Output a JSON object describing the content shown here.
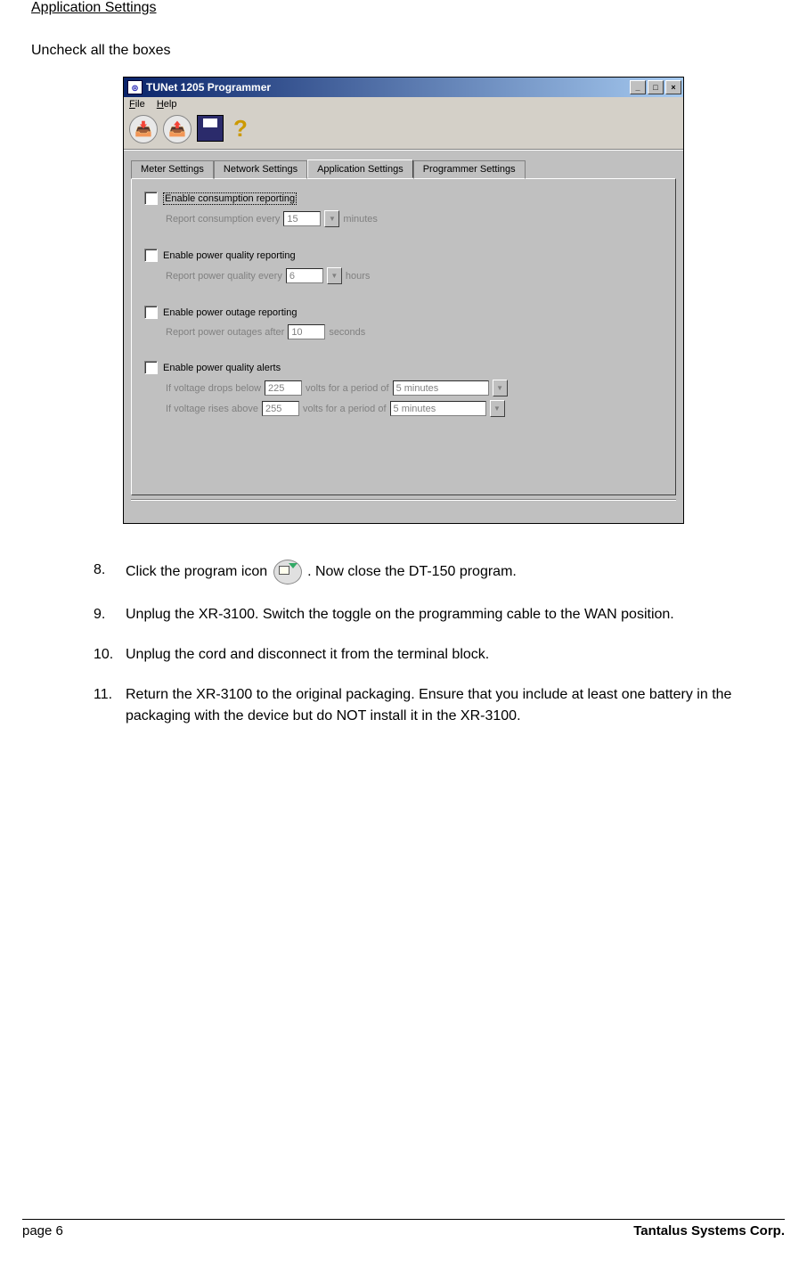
{
  "doc": {
    "section_title": "Application Settings",
    "instruction": "Uncheck all the boxes",
    "steps": [
      {
        "num": "8.",
        "pre": "Click the program icon ",
        "post": ".  Now close the DT-150 program."
      },
      {
        "num": "9.",
        "text": "Unplug the XR-3100. Switch the toggle on the programming cable to the WAN position."
      },
      {
        "num": "10.",
        "text": "Unplug the cord and disconnect it from the terminal block."
      },
      {
        "num": "11.",
        "text": "Return the XR-3100 to the original packaging. Ensure that you include at least one battery in the packaging with the device but do NOT install it in the XR-3100."
      }
    ],
    "footer_left": "page 6",
    "footer_right": "Tantalus Systems Corp."
  },
  "app": {
    "title": "TUNet 1205 Programmer",
    "menu": {
      "file": "File",
      "help": "Help"
    },
    "tabs": {
      "meter": "Meter Settings",
      "network": "Network Settings",
      "application": "Application Settings",
      "programmer": "Programmer Settings"
    },
    "groups": {
      "consumption": {
        "label": "Enable consumption reporting",
        "sub_pre": "Report consumption every",
        "value": "15",
        "sub_post": "minutes"
      },
      "power_quality": {
        "label": "Enable power quality reporting",
        "sub_pre": "Report power quality every",
        "value": "6",
        "sub_post": "hours"
      },
      "outage": {
        "label": "Enable power outage reporting",
        "sub_pre": "Report power outages after",
        "value": "10",
        "sub_post": "seconds"
      },
      "alerts": {
        "label": "Enable power quality alerts",
        "low_pre": "If voltage drops below",
        "low_val": "225",
        "mid": "volts for a period of",
        "low_period": "5 minutes",
        "high_pre": "If voltage rises above",
        "high_val": "255",
        "high_period": "5 minutes"
      }
    }
  }
}
